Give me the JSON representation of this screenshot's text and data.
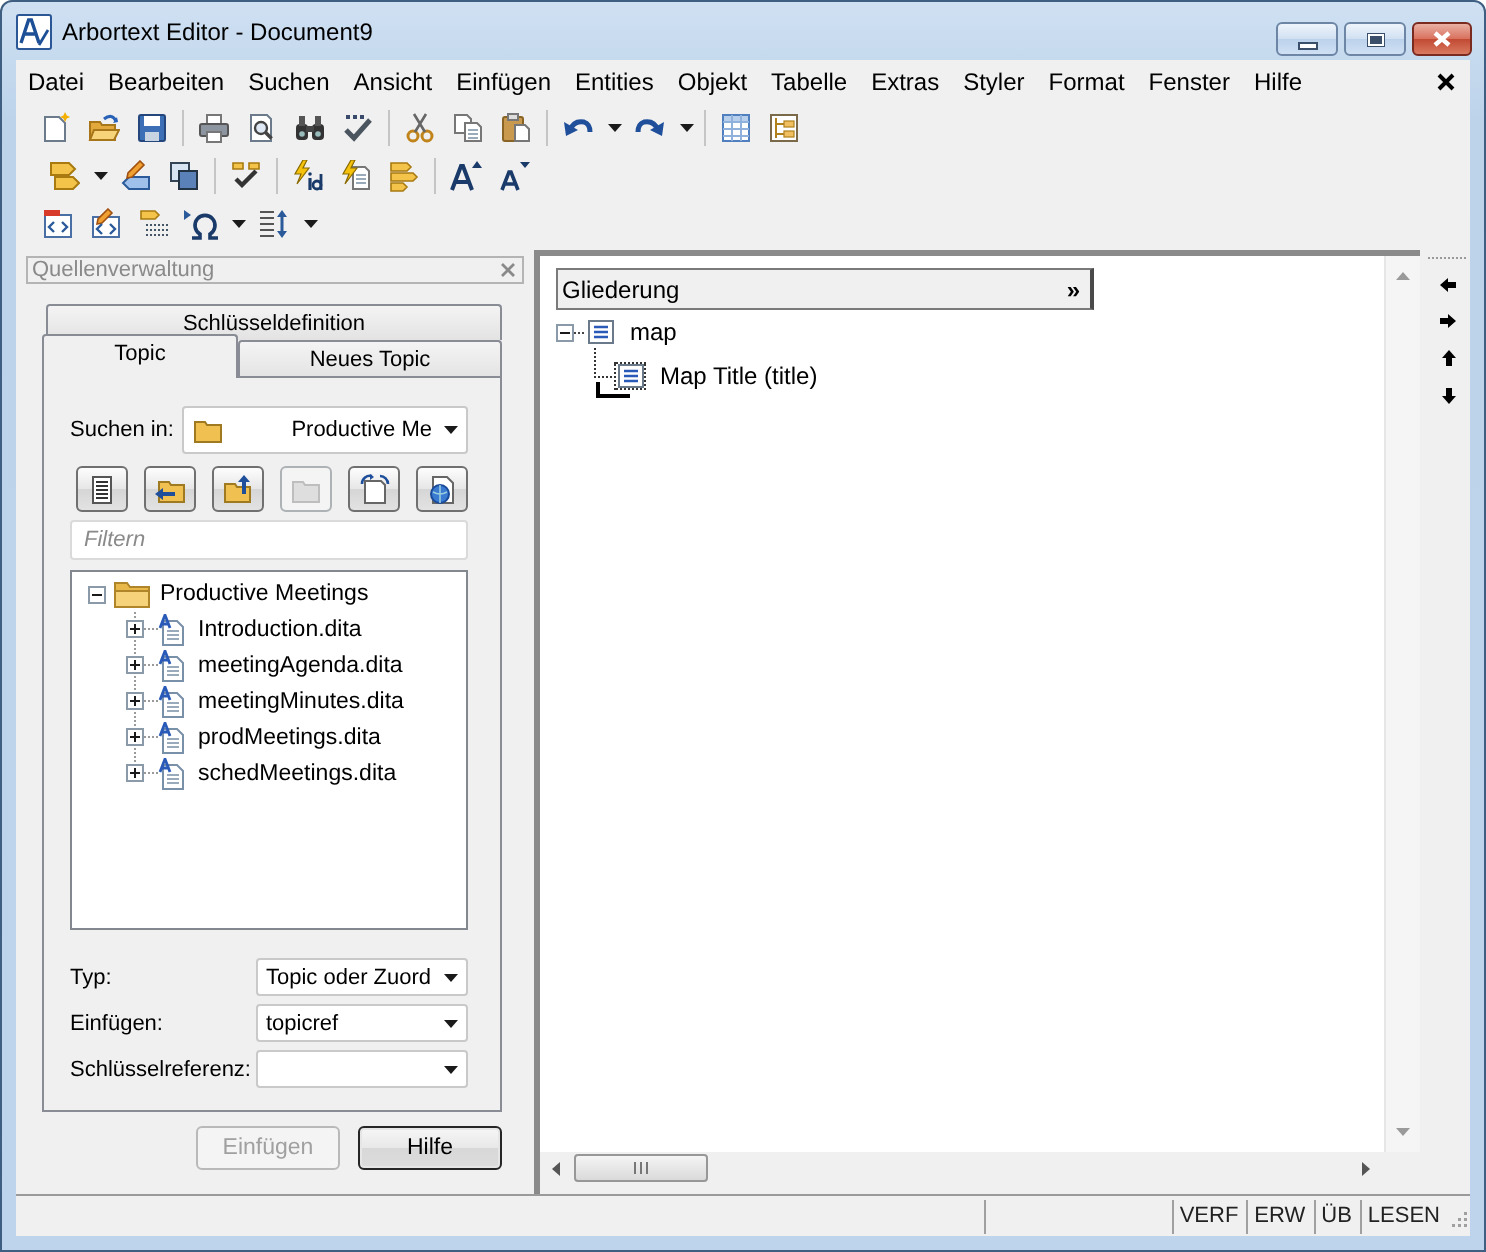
{
  "window": {
    "title": "Arbortext Editor - Document9"
  },
  "menu": [
    "Datei",
    "Bearbeiten",
    "Suchen",
    "Ansicht",
    "Einfügen",
    "Entities",
    "Objekt",
    "Tabelle",
    "Extras",
    "Styler",
    "Format",
    "Fenster",
    "Hilfe"
  ],
  "source_panel": {
    "title": "Quellenverwaltung",
    "tab_rows": [
      [
        {
          "label": "Schlüsseldefinition",
          "selected": false
        }
      ],
      [
        {
          "label": "Topic",
          "selected": true
        },
        {
          "label": "Neues Topic",
          "selected": false
        }
      ]
    ],
    "look_in": {
      "label": "Suchen in:",
      "value": "Productive Me"
    },
    "tool_buttons": [
      {
        "disabled": false
      },
      {
        "disabled": false
      },
      {
        "disabled": false
      },
      {
        "disabled": true
      },
      {
        "disabled": false
      },
      {
        "disabled": false
      }
    ],
    "filter": {
      "placeholder": "Filtern"
    },
    "tree": [
      {
        "label": "Productive Meetings",
        "expanded": true,
        "selected": false,
        "children": [
          {
            "label": "Introduction.dita",
            "expanded": false,
            "selected": false
          },
          {
            "label": "meetingAgenda.dita",
            "expanded": false,
            "selected": false
          },
          {
            "label": "meetingMinutes.dita",
            "expanded": false,
            "selected": false
          },
          {
            "label": "prodMeetings.dita",
            "expanded": false,
            "selected": false
          },
          {
            "label": "schedMeetings.dita",
            "expanded": false,
            "selected": false
          }
        ]
      }
    ],
    "fields": [
      {
        "label": "Typ:",
        "value": "Topic oder Zuord"
      },
      {
        "label": "Einfügen:",
        "value": "topicref"
      },
      {
        "label": "Schlüsselreferenz:"
      }
    ],
    "buttons": [
      {
        "label": "Einfügen",
        "disabled": true
      },
      {
        "label": "Hilfe",
        "disabled": false
      }
    ]
  },
  "editor": {
    "outline": {
      "title": "Gliederung",
      "toggle": "»",
      "tree": [
        {
          "label": "map",
          "expanded": true,
          "selected": false,
          "children": [
            {
              "label": "Map Title (title)",
              "selected": true
            }
          ]
        }
      ]
    }
  },
  "status_bar": {
    "fields": [
      "VERF",
      "ERW",
      "ÜB",
      "LESEN"
    ]
  }
}
